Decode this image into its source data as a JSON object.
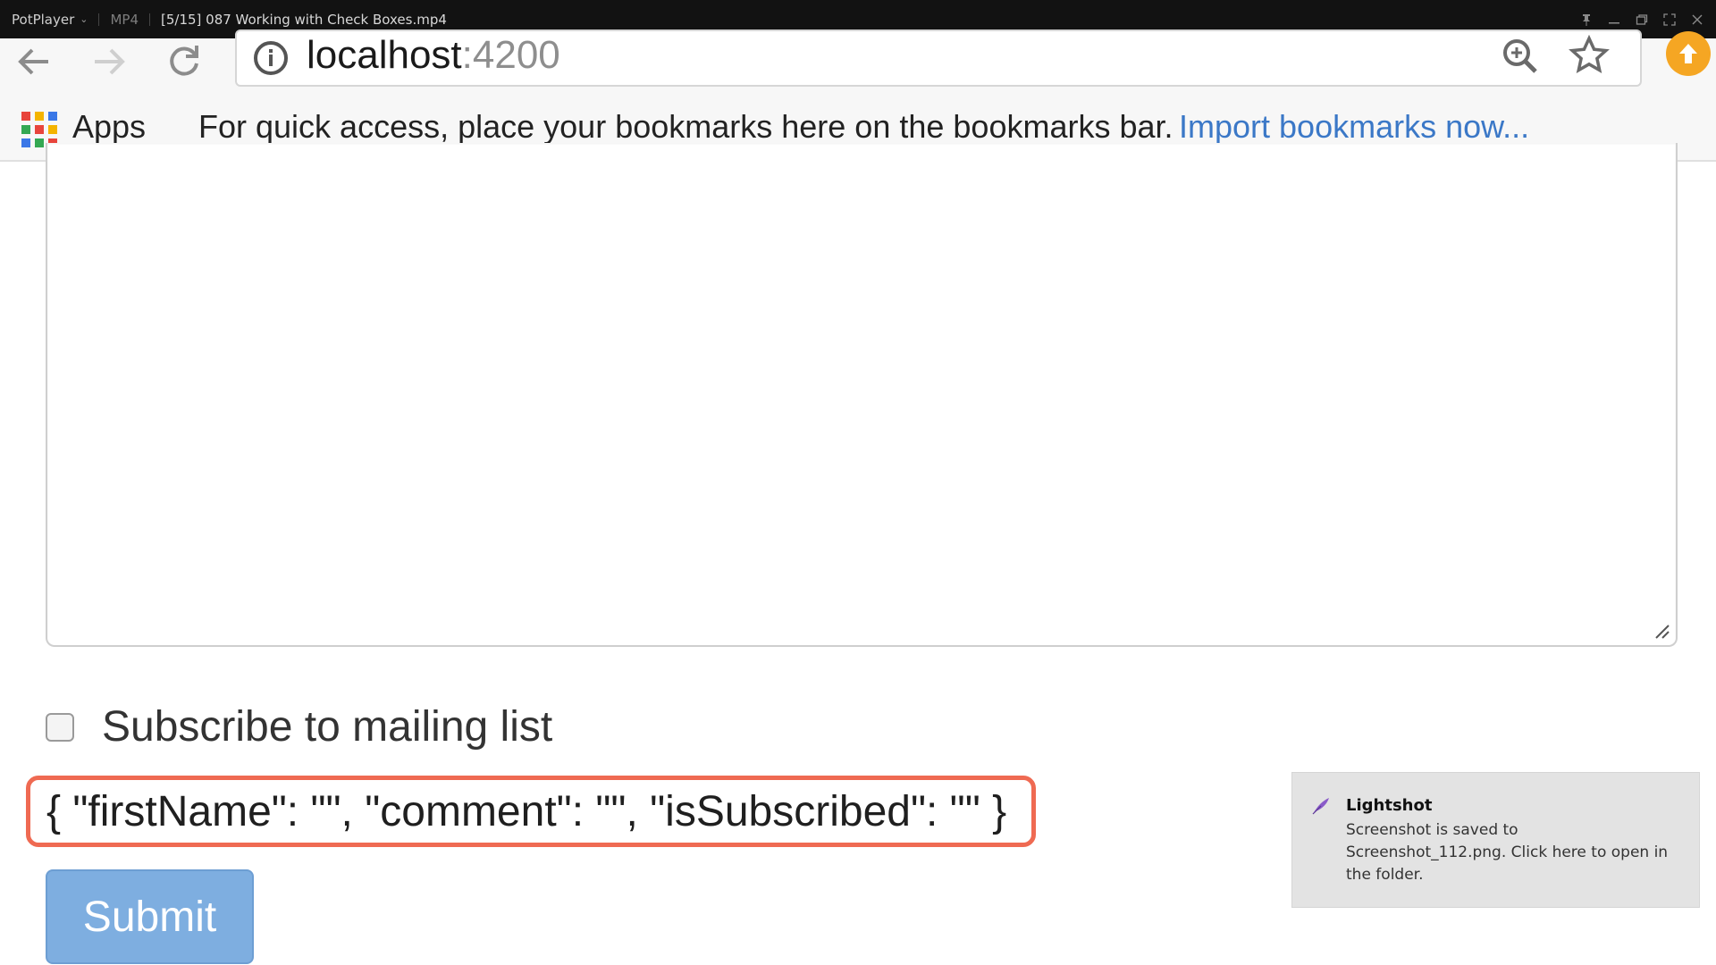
{
  "player": {
    "app_name": "PotPlayer",
    "format": "MP4",
    "file_title": "[5/15] 087 Working with Check Boxes.mp4"
  },
  "browser": {
    "url_host": "localhost",
    "url_port": ":4200",
    "apps_label": "Apps",
    "bookmarks_hint": "For quick access, place your bookmarks here on the bookmarks bar.",
    "import_link": "Import bookmarks now...",
    "apps_colors": [
      "#e8453c",
      "#f4b400",
      "#3b78e7",
      "#34a853",
      "#e8453c",
      "#f4b400",
      "#3b78e7",
      "#34a853",
      "#e8453c"
    ]
  },
  "form": {
    "comment_value": "",
    "subscribe_label": "Subscribe to mailing list",
    "subscribe_checked": false,
    "json_output": "{ \"firstName\": \"\", \"comment\": \"\", \"isSubscribed\": \"\" }",
    "submit_label": "Submit"
  },
  "notification": {
    "title": "Lightshot",
    "message": "Screenshot is saved to Screenshot_112.png. Click here to open in the folder."
  },
  "colors": {
    "highlight_border": "#ef6a52",
    "submit_bg": "#7eaee0",
    "link": "#3b78c7"
  }
}
